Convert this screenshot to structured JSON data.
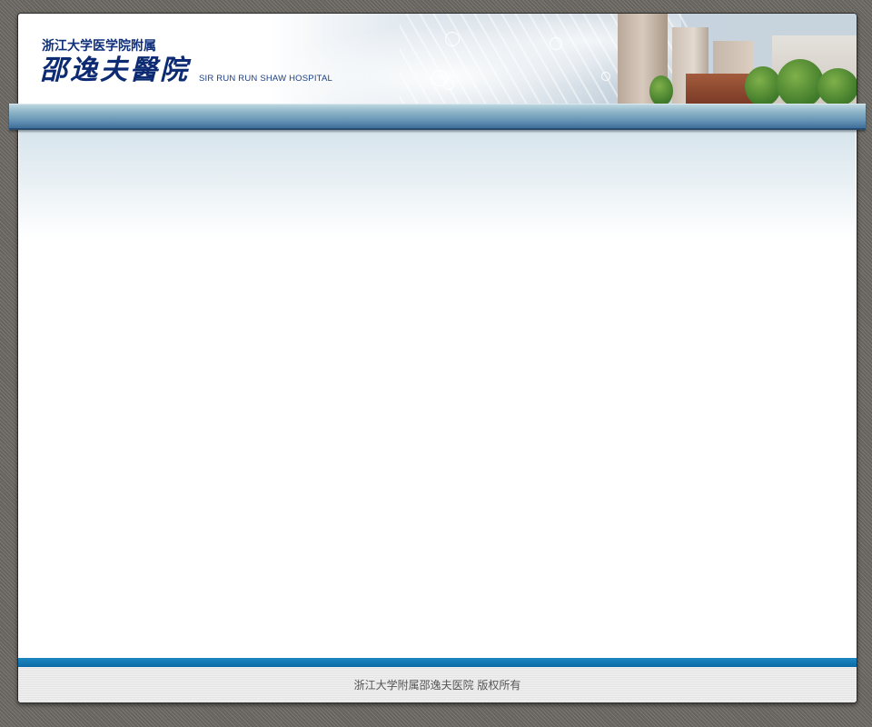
{
  "header": {
    "logo_subtitle": "浙江大学医学院附属",
    "logo_title": "邵逸夫醫院",
    "logo_english": "SIR RUN RUN SHAW HOSPITAL"
  },
  "footer": {
    "copyright": "浙江大学附属邵逸夫医院  版权所有"
  },
  "colors": {
    "brand_blue": "#0d2b73",
    "nav_bar": "#6a97b7",
    "footer_stripe": "#1d87c2",
    "background": "#6f6c66"
  }
}
